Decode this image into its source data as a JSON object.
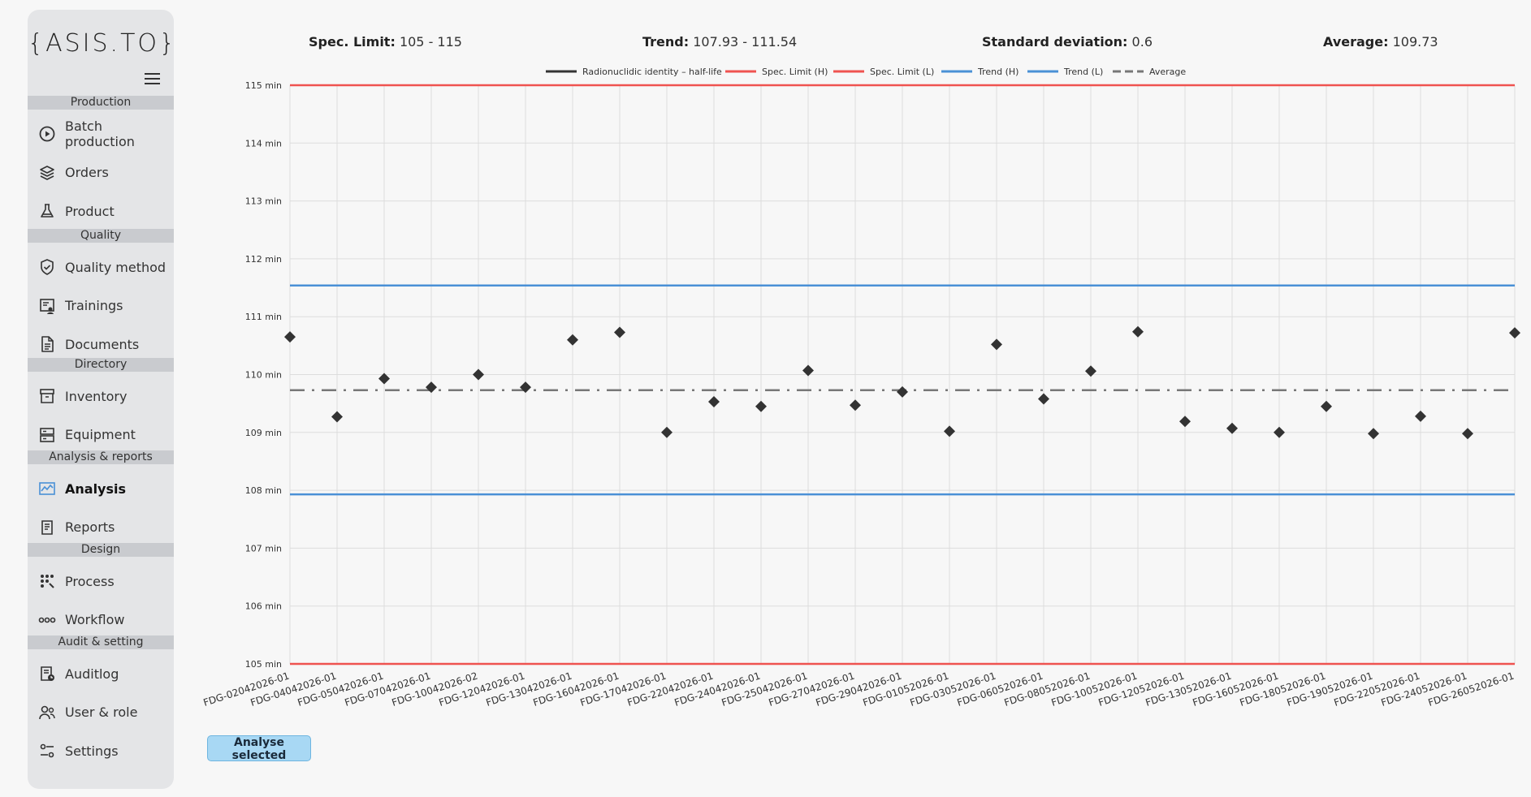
{
  "app": {
    "logo_text": "{ASIS.TO}"
  },
  "sidebar": {
    "sections": [
      {
        "label": "Production",
        "items": [
          {
            "label": "Batch production",
            "icon": "play-circle-icon"
          },
          {
            "label": "Orders",
            "icon": "layers-icon"
          },
          {
            "label": "Product",
            "icon": "flask-icon"
          }
        ]
      },
      {
        "label": "Quality",
        "items": [
          {
            "label": "Quality method",
            "icon": "shield-check-icon"
          },
          {
            "label": "Trainings",
            "icon": "training-icon"
          },
          {
            "label": "Documents",
            "icon": "document-icon"
          }
        ]
      },
      {
        "label": "Directory",
        "items": [
          {
            "label": "Inventory",
            "icon": "archive-icon"
          },
          {
            "label": "Equipment",
            "icon": "equipment-icon"
          }
        ]
      },
      {
        "label": "Analysis & reports",
        "items": [
          {
            "label": "Analysis",
            "icon": "chart-icon",
            "active": true
          },
          {
            "label": "Reports",
            "icon": "report-icon"
          }
        ]
      },
      {
        "label": "Design",
        "items": [
          {
            "label": "Process",
            "icon": "process-icon"
          },
          {
            "label": "Workflow",
            "icon": "workflow-icon"
          }
        ]
      },
      {
        "label": "Audit & setting",
        "items": [
          {
            "label": "Auditlog",
            "icon": "auditlog-icon"
          },
          {
            "label": "User & role",
            "icon": "users-icon"
          },
          {
            "label": "Settings",
            "icon": "settings-icon"
          }
        ]
      }
    ]
  },
  "stats": {
    "spec_label": "Spec. Limit:",
    "spec_value": "105 - 115",
    "trend_label": "Trend:",
    "trend_value": "107.93 - 111.54",
    "std_label": "Standard deviation:",
    "std_value": "0.6",
    "avg_label": "Average:",
    "avg_value": "109.73"
  },
  "button": {
    "analyse_label": "Analyse selected"
  },
  "colors": {
    "spec": "#ef5350",
    "trend": "#4a90d6",
    "average": "#777777",
    "series": "#333333",
    "accent": "#a8d8f4"
  },
  "chart_data": {
    "type": "scatter",
    "legend": [
      {
        "name": "Radionuclidic identity – half-life",
        "style": "solid",
        "color": "#333333"
      },
      {
        "name": "Spec. Limit (H)",
        "style": "solid",
        "color": "#ef5350"
      },
      {
        "name": "Spec. Limit (L)",
        "style": "solid",
        "color": "#ef5350"
      },
      {
        "name": "Trend (H)",
        "style": "solid",
        "color": "#4a90d6"
      },
      {
        "name": "Trend (L)",
        "style": "solid",
        "color": "#4a90d6"
      },
      {
        "name": "Average",
        "style": "dashed",
        "color": "#777777"
      }
    ],
    "legend_position": "top-center",
    "ylim": [
      105,
      115
    ],
    "y_ticks": [
      105,
      106,
      107,
      108,
      109,
      110,
      111,
      112,
      113,
      114,
      115
    ],
    "y_unit": "min",
    "grid": true,
    "categories": [
      "FDG-02042026-01",
      "FDG-04042026-01",
      "FDG-05042026-01",
      "FDG-07042026-01",
      "FDG-10042026-02",
      "FDG-12042026-01",
      "FDG-13042026-01",
      "FDG-16042026-01",
      "FDG-17042026-01",
      "FDG-22042026-01",
      "FDG-24042026-01",
      "FDG-25042026-01",
      "FDG-27042026-01",
      "FDG-29042026-01",
      "FDG-01052026-01",
      "FDG-03052026-01",
      "FDG-06052026-01",
      "FDG-08052026-01",
      "FDG-10052026-01",
      "FDG-12052026-01",
      "FDG-13052026-01",
      "FDG-16052026-01",
      "FDG-18052026-01",
      "FDG-19052026-01",
      "FDG-22052026-01",
      "FDG-24052026-01",
      "FDG-26052026-01"
    ],
    "series": [
      {
        "name": "Radionuclidic identity – half-life",
        "values": [
          110.65,
          109.27,
          109.93,
          109.78,
          110.0,
          109.78,
          110.6,
          110.73,
          109.0,
          109.53,
          109.45,
          110.07,
          109.47,
          109.7,
          109.02,
          110.52,
          109.58,
          110.06,
          110.74,
          109.19,
          109.07,
          109.0,
          109.45,
          108.98,
          109.28,
          108.98,
          110.72
        ]
      }
    ],
    "spec_high": 115,
    "spec_low": 105,
    "trend_high": 111.54,
    "trend_low": 107.93,
    "average": 109.73
  }
}
